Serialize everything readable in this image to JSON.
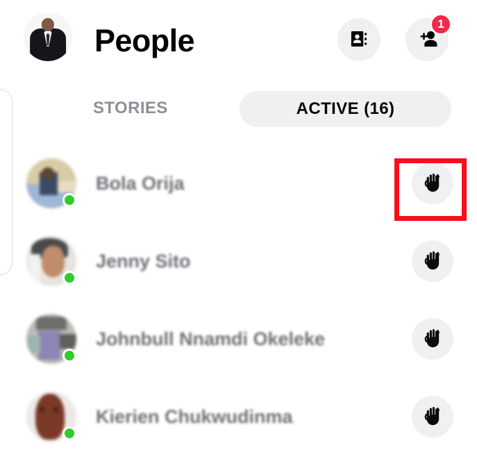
{
  "header": {
    "title": "People",
    "avatar_name": "user-profile-photo",
    "contacts_icon": "contacts-book-icon",
    "add_person_icon": "add-person-icon",
    "add_person_badge": "1",
    "badge_color": "#f02849"
  },
  "tabs": [
    {
      "id": "stories",
      "label": "STORIES",
      "active": false
    },
    {
      "id": "active",
      "label": "ACTIVE (16)",
      "active": true
    }
  ],
  "active_count": 16,
  "people": [
    {
      "name": "Bola Orija",
      "status": "active",
      "wave_icon": "wave-hand-icon",
      "highlighted": true
    },
    {
      "name": "Jenny Sito",
      "status": "active",
      "wave_icon": "wave-hand-icon",
      "highlighted": false
    },
    {
      "name": "Johnbull Nnamdi Okeleke",
      "status": "active",
      "wave_icon": "wave-hand-icon",
      "highlighted": false
    },
    {
      "name": "Kierien Chukwudinma",
      "status": "active",
      "wave_icon": "wave-hand-icon",
      "highlighted": false
    }
  ],
  "colors": {
    "accent_red": "#fc0d1b",
    "badge_red": "#f02849",
    "online_green": "#31cc2a",
    "pill_gray": "#eff0f1",
    "inactive_text": "#8d9096",
    "name_text": "#6d7075",
    "title_text": "#050505"
  }
}
